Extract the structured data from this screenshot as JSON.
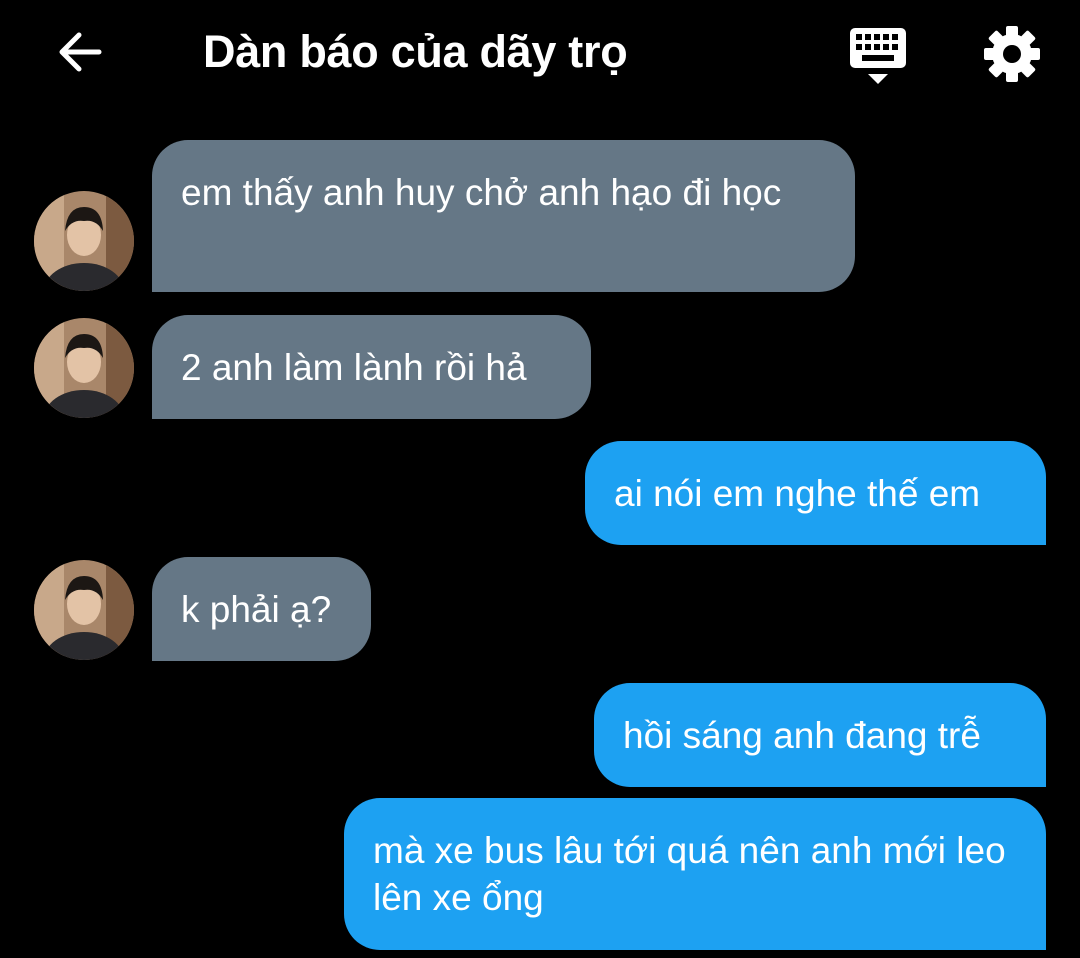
{
  "header": {
    "title": "Dàn báo của dãy trọ",
    "back_icon": "arrow-left-icon",
    "keyboard_icon": "keyboard-icon",
    "settings_icon": "gear-icon"
  },
  "colors": {
    "background": "#000000",
    "received_bubble": "#657786",
    "sent_bubble": "#1da1f2",
    "text": "#ffffff"
  },
  "messages": [
    {
      "direction": "received",
      "text": "em thấy anh huy chở anh hạo đi học"
    },
    {
      "direction": "received",
      "text": "2 anh làm lành rồi hả"
    },
    {
      "direction": "sent",
      "text": "ai nói em nghe thế em"
    },
    {
      "direction": "received",
      "text": "k phải ạ?"
    },
    {
      "direction": "sent",
      "text": "hồi sáng anh đang trễ"
    },
    {
      "direction": "sent",
      "text": "mà xe bus lâu tới quá nên anh mới leo lên xe ổng"
    }
  ]
}
